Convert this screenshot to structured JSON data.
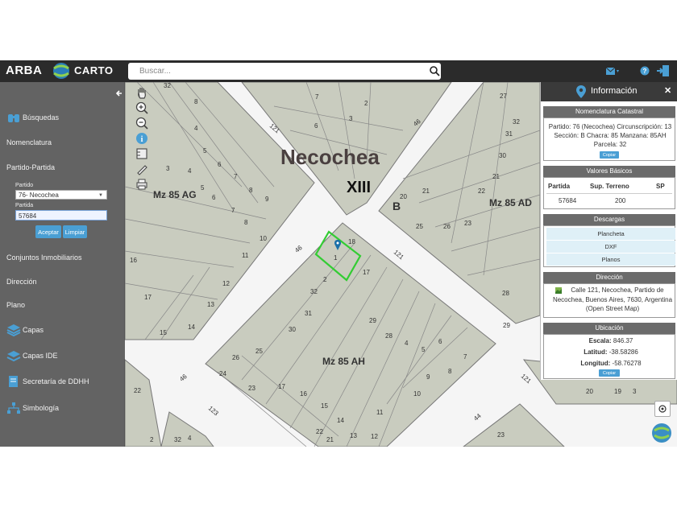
{
  "topbar": {
    "brand": "ARBA",
    "app_name": "CARTO",
    "search_placeholder": "Buscar..."
  },
  "sidebar": {
    "items": [
      {
        "label": "Búsquedas"
      },
      {
        "label": "Nomenclatura"
      },
      {
        "label": "Partido-Partida"
      },
      {
        "label": "Conjuntos Inmobiliarios"
      },
      {
        "label": "Dirección"
      },
      {
        "label": "Plano"
      },
      {
        "label": "Capas"
      },
      {
        "label": "Capas IDE"
      },
      {
        "label": "Secretaría de DDHH"
      },
      {
        "label": "Simbología"
      }
    ],
    "partido_label": "Partido",
    "partido_value": "76- Necochea",
    "partida_label": "Partida",
    "partida_value": "57684",
    "aceptar": "Aceptar",
    "limpiar": "Limpiar"
  },
  "map": {
    "city": "Necochea",
    "roman": "XIII",
    "section": "B",
    "manzanas": [
      "Mz 85 AG",
      "Mz 85 AD",
      "Mz 85 AH"
    ],
    "streets": [
      "121",
      "46",
      "46",
      "121",
      "121",
      "46",
      "123",
      "44"
    ],
    "lots": [
      "32",
      "7",
      "2",
      "8",
      "6",
      "3",
      "4",
      "5",
      "6",
      "7",
      "8",
      "9",
      "3",
      "4",
      "5",
      "6",
      "7",
      "8",
      "10",
      "11",
      "12",
      "13",
      "14",
      "15",
      "16",
      "17",
      "20",
      "21",
      "25",
      "26",
      "23",
      "22",
      "21",
      "30",
      "31",
      "32",
      "29",
      "28",
      "27",
      "18",
      "17",
      "1",
      "2",
      "32",
      "31",
      "30",
      "29",
      "28",
      "4",
      "5",
      "6",
      "7",
      "8",
      "9",
      "10",
      "11",
      "12",
      "13",
      "14",
      "15",
      "16",
      "17",
      "25",
      "26",
      "24",
      "23",
      "22",
      "21",
      "20",
      "19",
      "3",
      "4",
      "2",
      "32",
      "23",
      "22",
      "21",
      "1",
      "3",
      "2",
      "32",
      "8"
    ]
  },
  "info": {
    "title": "Información",
    "nomenclatura": {
      "header": "Nomenclatura Catastral",
      "line1": "Partido: 76 (Necochea) Circunscripción: 13",
      "line2": "Sección: B Chacra: 85 Manzana: 85AH",
      "line3": "Parcela: 32",
      "copy": "Copiar"
    },
    "valores": {
      "header": "Valores Básicos",
      "cols": [
        "Partida",
        "Sup. Terreno",
        "SP"
      ],
      "row": [
        "57684",
        "200",
        ""
      ]
    },
    "descargas": {
      "header": "Descargas",
      "items": [
        "Plancheta",
        "DXF",
        "Planos"
      ]
    },
    "direccion": {
      "header": "Dirección",
      "line1": "Calle 121, Necochea, Partido de",
      "line2": "Necochea, Buenos Aires, 7630, Argentina",
      "line3": "(Open Street Map)"
    },
    "ubicacion": {
      "header": "Ubicación",
      "escala_label": "Escala:",
      "escala_value": "846.37",
      "latitud_label": "Latitud:",
      "latitud_value": "-38.58286",
      "longitud_label": "Longitud:",
      "longitud_value": "-58.76278",
      "copy": "Copiar"
    }
  },
  "colors": {
    "topbar": "#2b2b2b",
    "block": "#c9ccbf",
    "street": "#f4f4f4",
    "selected": "#33cc33",
    "accent": "#4a9fd4"
  }
}
